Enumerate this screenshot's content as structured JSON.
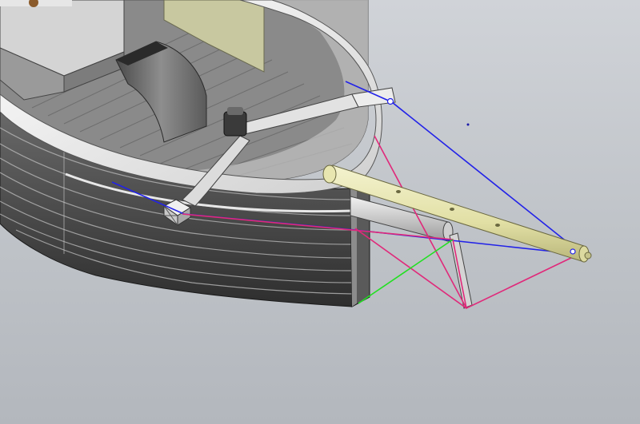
{
  "viewport": {
    "background_top": "#d0d3d8",
    "background_bottom": "#b3b7bd"
  },
  "colors": {
    "hull_light": "#e6e6e6",
    "hull_mid": "#a8a8a8",
    "hull_dark": "#3c3c3c",
    "plank_dark": "#262626",
    "deck": "#8a8a8a",
    "bowsprit": "#e8e7b6",
    "rig_blue": "#2222e8",
    "rig_magenta": "#e0297a",
    "rig_green": "#22e022"
  },
  "icons": [
    "bollard-icon",
    "origin-point-icon"
  ]
}
